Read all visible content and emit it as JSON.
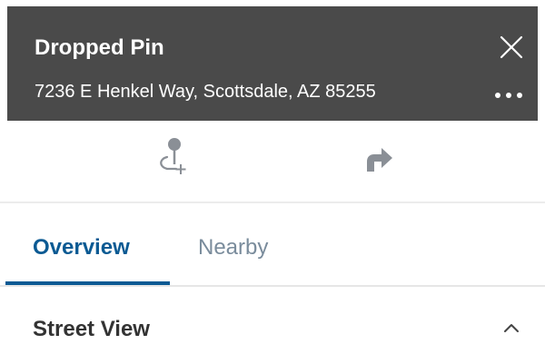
{
  "header": {
    "title": "Dropped Pin",
    "address": "7236 E Henkel Way, Scottsdale, AZ 85255",
    "background_color": "#4a4a4a",
    "close_icon": "close-icon",
    "more_icon": "more-horizontal-icon"
  },
  "actions": {
    "add_pin_icon": "add-pin-icon",
    "directions_icon": "directions-icon",
    "icon_color": "#8a8f96"
  },
  "tabs": {
    "items": [
      {
        "label": "Overview",
        "selected": true
      },
      {
        "label": "Nearby",
        "selected": false
      }
    ],
    "accent_color": "#0b5a93"
  },
  "section": {
    "title": "Street View",
    "expanded": true,
    "chevron_icon": "chevron-up-icon"
  }
}
